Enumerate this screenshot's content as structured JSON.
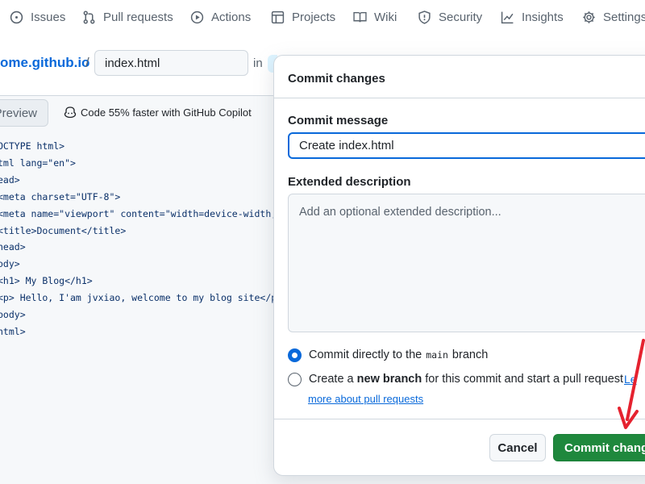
{
  "nav": {
    "items": [
      {
        "label": "Issues",
        "icon": "issue-opened-icon"
      },
      {
        "label": "Pull requests",
        "icon": "git-pull-request-icon"
      },
      {
        "label": "Actions",
        "icon": "play-icon"
      },
      {
        "label": "Projects",
        "icon": "table-icon"
      },
      {
        "label": "Wiki",
        "icon": "book-icon"
      },
      {
        "label": "Security",
        "icon": "shield-icon"
      },
      {
        "label": "Insights",
        "icon": "graph-icon"
      },
      {
        "label": "Settings",
        "icon": "gear-icon"
      }
    ]
  },
  "breadcrumb": {
    "repo": "ome.github.io",
    "separator": "/",
    "filename": "index.html",
    "in_label": "in"
  },
  "editor": {
    "preview_tab": "Preview",
    "copilot_hint": "Code 55% faster with GitHub Copilot",
    "lines": [
      "OCTYPE html>",
      "tml lang=\"en\">",
      "ead>",
      "<meta charset=\"UTF-8\">",
      "<meta name=\"viewport\" content=\"width=device-width,",
      "<title>Document</title>",
      "head>",
      "ody>",
      "<h1> My Blog</h1>",
      "<p> Hello, I'am jvxiao, welcome to my blog site</p",
      "body>",
      "html>"
    ]
  },
  "dialog": {
    "title": "Commit changes",
    "commit_message_label": "Commit message",
    "commit_message_value": "Create index.html",
    "extended_description_label": "Extended description",
    "extended_description_placeholder": "Add an optional extended description...",
    "option_direct": {
      "prefix": "Commit directly to the",
      "branch": "main",
      "suffix": "branch",
      "selected": true
    },
    "option_new_branch": {
      "prefix": "Create a",
      "bold": "new branch",
      "suffix": "for this commit and start a pull request",
      "selected": false,
      "learn_more_1": "Le",
      "learn_more_2": "more about pull requests"
    },
    "cancel_label": "Cancel",
    "commit_label": "Commit change"
  },
  "colors": {
    "accent": "#0969da",
    "primary_button": "#1f883d",
    "annotation_arrow": "#e5222f"
  }
}
